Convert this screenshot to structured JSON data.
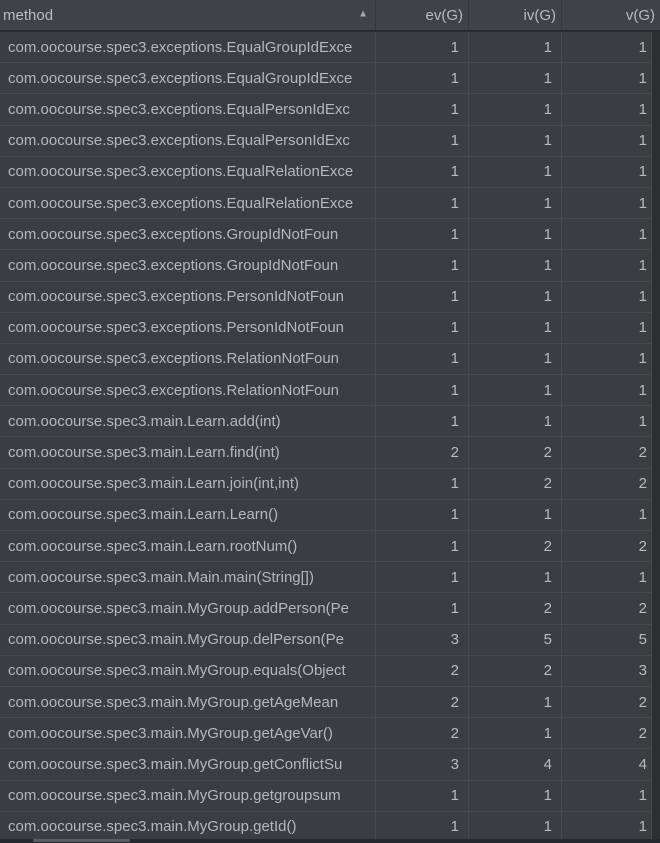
{
  "table": {
    "columns": [
      {
        "key": "method",
        "label": "method",
        "sorted": "ascending"
      },
      {
        "key": "ev",
        "label": "ev(G)"
      },
      {
        "key": "iv",
        "label": "iv(G)"
      },
      {
        "key": "v",
        "label": "v(G)"
      }
    ],
    "sort_icon": "▲",
    "rows": [
      {
        "method": "com.oocourse.spec3.exceptions.EqualGroupIdExce",
        "ev": 1,
        "iv": 1,
        "v": 1
      },
      {
        "method": "com.oocourse.spec3.exceptions.EqualGroupIdExce",
        "ev": 1,
        "iv": 1,
        "v": 1
      },
      {
        "method": "com.oocourse.spec3.exceptions.EqualPersonIdExc",
        "ev": 1,
        "iv": 1,
        "v": 1
      },
      {
        "method": "com.oocourse.spec3.exceptions.EqualPersonIdExc",
        "ev": 1,
        "iv": 1,
        "v": 1
      },
      {
        "method": "com.oocourse.spec3.exceptions.EqualRelationExce",
        "ev": 1,
        "iv": 1,
        "v": 1
      },
      {
        "method": "com.oocourse.spec3.exceptions.EqualRelationExce",
        "ev": 1,
        "iv": 1,
        "v": 1
      },
      {
        "method": "com.oocourse.spec3.exceptions.GroupIdNotFoun",
        "ev": 1,
        "iv": 1,
        "v": 1
      },
      {
        "method": "com.oocourse.spec3.exceptions.GroupIdNotFoun",
        "ev": 1,
        "iv": 1,
        "v": 1
      },
      {
        "method": "com.oocourse.spec3.exceptions.PersonIdNotFoun",
        "ev": 1,
        "iv": 1,
        "v": 1
      },
      {
        "method": "com.oocourse.spec3.exceptions.PersonIdNotFoun",
        "ev": 1,
        "iv": 1,
        "v": 1
      },
      {
        "method": "com.oocourse.spec3.exceptions.RelationNotFoun",
        "ev": 1,
        "iv": 1,
        "v": 1
      },
      {
        "method": "com.oocourse.spec3.exceptions.RelationNotFoun",
        "ev": 1,
        "iv": 1,
        "v": 1
      },
      {
        "method": "com.oocourse.spec3.main.Learn.add(int)",
        "ev": 1,
        "iv": 1,
        "v": 1
      },
      {
        "method": "com.oocourse.spec3.main.Learn.find(int)",
        "ev": 2,
        "iv": 2,
        "v": 2
      },
      {
        "method": "com.oocourse.spec3.main.Learn.join(int,int)",
        "ev": 1,
        "iv": 2,
        "v": 2
      },
      {
        "method": "com.oocourse.spec3.main.Learn.Learn()",
        "ev": 1,
        "iv": 1,
        "v": 1
      },
      {
        "method": "com.oocourse.spec3.main.Learn.rootNum()",
        "ev": 1,
        "iv": 2,
        "v": 2
      },
      {
        "method": "com.oocourse.spec3.main.Main.main(String[])",
        "ev": 1,
        "iv": 1,
        "v": 1
      },
      {
        "method": "com.oocourse.spec3.main.MyGroup.addPerson(Pe",
        "ev": 1,
        "iv": 2,
        "v": 2
      },
      {
        "method": "com.oocourse.spec3.main.MyGroup.delPerson(Pe",
        "ev": 3,
        "iv": 5,
        "v": 5
      },
      {
        "method": "com.oocourse.spec3.main.MyGroup.equals(Object",
        "ev": 2,
        "iv": 2,
        "v": 3
      },
      {
        "method": "com.oocourse.spec3.main.MyGroup.getAgeMean",
        "ev": 2,
        "iv": 1,
        "v": 2
      },
      {
        "method": "com.oocourse.spec3.main.MyGroup.getAgeVar()",
        "ev": 2,
        "iv": 1,
        "v": 2
      },
      {
        "method": "com.oocourse.spec3.main.MyGroup.getConflictSu",
        "ev": 3,
        "iv": 4,
        "v": 4
      },
      {
        "method": "com.oocourse.spec3.main.MyGroup.getgroupsum",
        "ev": 1,
        "iv": 1,
        "v": 1
      },
      {
        "method": "com.oocourse.spec3.main.MyGroup.getId()",
        "ev": 1,
        "iv": 1,
        "v": 1
      }
    ]
  },
  "colors": {
    "background": "#3b3e40",
    "header_background": "#3f4345",
    "grid_line": "#47494c",
    "header_separator": "#292c2e",
    "text": "#b6babd",
    "scrollbar_track": "#2c2e30",
    "scrollbar_thumb": "#5a5d5f"
  }
}
